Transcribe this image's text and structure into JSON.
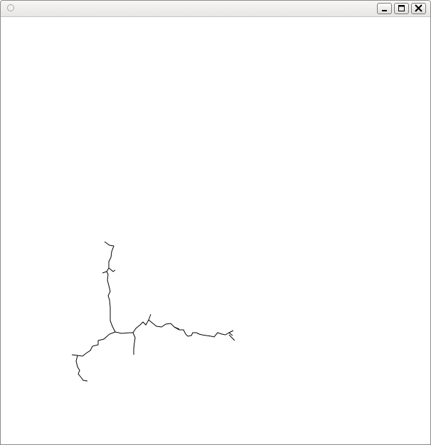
{
  "window": {
    "title": "",
    "app_icon": "app-circle-icon",
    "controls": {
      "minimize_icon": "minimize-icon",
      "maximize_icon": "maximize-icon",
      "close_icon": "close-icon"
    }
  },
  "canvas": {
    "background": "#ffffff",
    "stroke_color": "#000000",
    "drawing": "fractal-crack"
  }
}
